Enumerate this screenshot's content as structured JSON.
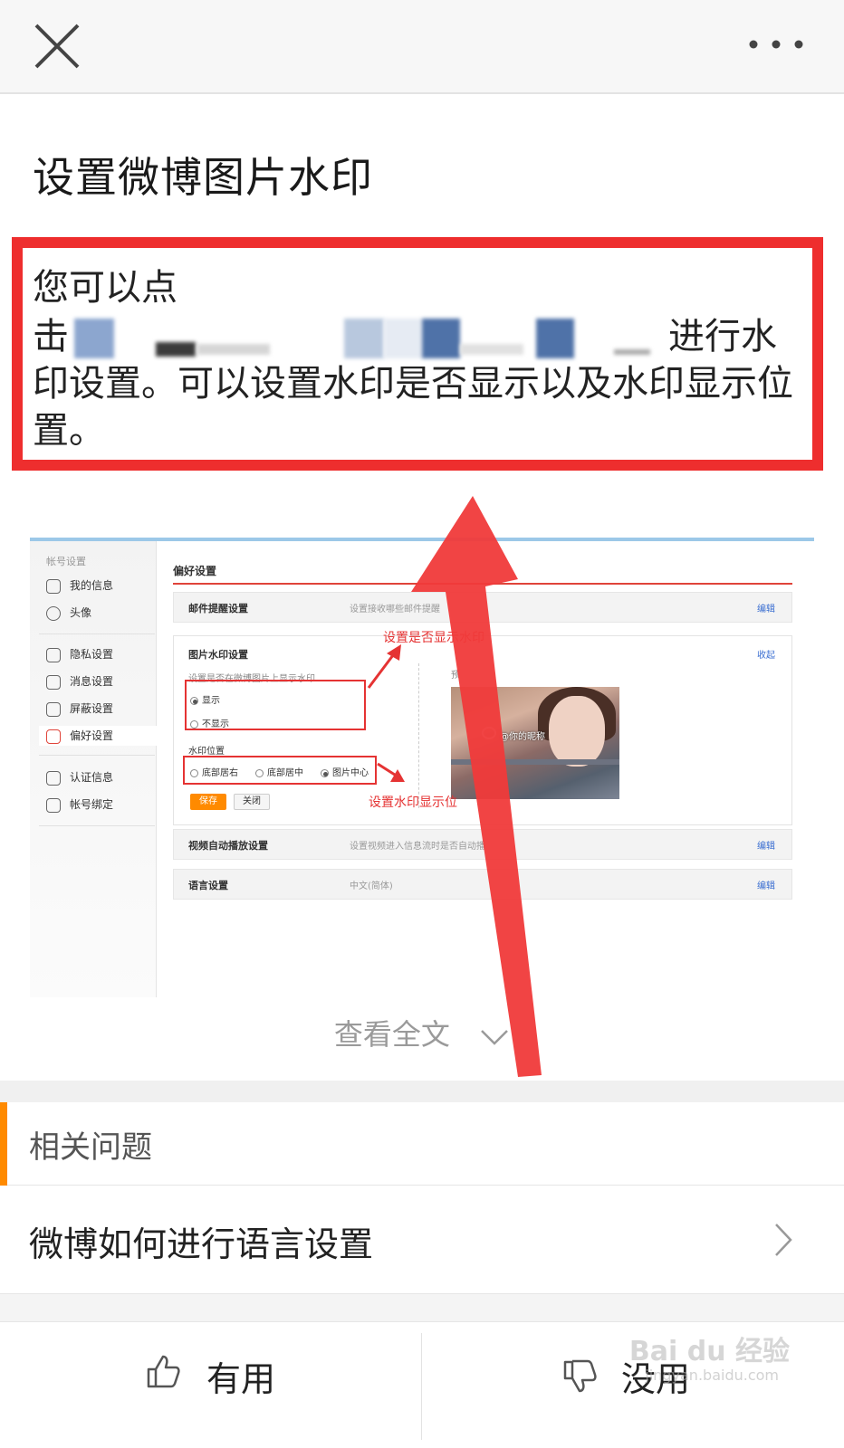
{
  "header": {
    "close_icon": "close-icon",
    "more_icon": "more-dots-icon"
  },
  "article": {
    "title": "设置微博图片水印",
    "intro_line1": "您可以点",
    "intro_line2_start": "击",
    "intro_line2_end": "进行水",
    "intro_line3": "印设置。可以设置水印是否显示以及水印显示位",
    "intro_line4": "置。"
  },
  "screenshot": {
    "sidebar_head": "帐号设置",
    "sidebar_items": [
      "我的信息",
      "头像",
      "隐私设置",
      "消息设置",
      "屏蔽设置",
      "偏好设置",
      "认证信息",
      "帐号绑定"
    ],
    "main_title": "偏好设置",
    "rows": [
      {
        "label": "邮件提醒设置",
        "desc": "设置接收哪些邮件提醒",
        "action": "编辑"
      },
      {
        "label": "视频自动播放设置",
        "desc": "设置视频进入信息流时是否自动播",
        "action": "编辑"
      },
      {
        "label": "语言设置",
        "desc": "中文(简体)",
        "action": "编辑"
      }
    ],
    "watermark": {
      "title": "图片水印设置",
      "collapse": "收起",
      "question": "设置是否在微博图片上显示水印",
      "show_option": "显示",
      "hide_option": "不显示",
      "position_label": "水印位置",
      "position_options": [
        "底部居右",
        "底部居中",
        "图片中心"
      ],
      "save": "保存",
      "close": "关闭",
      "preview_label": "预",
      "wm_text": "@你的昵称"
    },
    "annotations": {
      "show": "设置是否显示水印",
      "position": "设置水印显示位"
    }
  },
  "view_all": "查看全文",
  "related": {
    "title": "相关问题",
    "items": [
      "微博如何进行语言设置"
    ]
  },
  "feedback": {
    "useful": "有用",
    "useless": "没用"
  },
  "site_watermark": {
    "main": "Bai du 经验",
    "sub": "jingyan.baidu.com"
  },
  "colors": {
    "accent_red": "#ee2e2e",
    "accent_orange": "#ff8a00",
    "link_blue": "#3a6ed1"
  }
}
